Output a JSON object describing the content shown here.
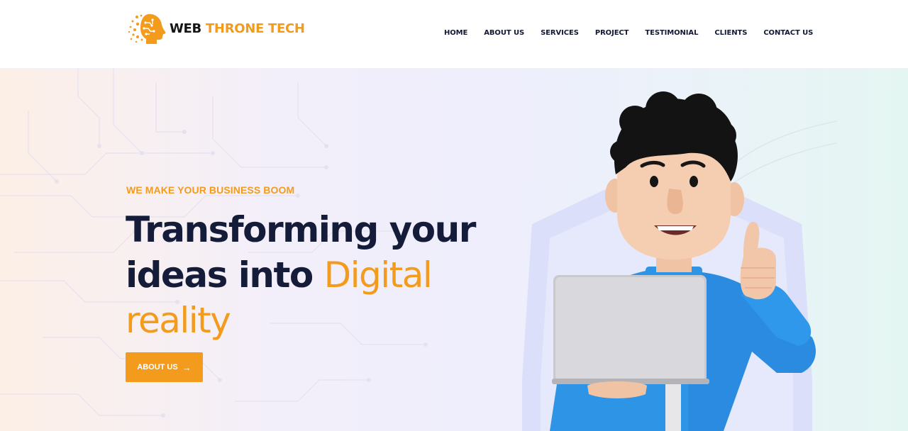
{
  "brand": {
    "name_part1": "WEB",
    "name_part2": "THRONE TECH",
    "accent_color": "#f29b1d",
    "dark_color": "#141c3a",
    "icon": "ai-head-logo-icon"
  },
  "nav": {
    "items": [
      {
        "label": "HOME"
      },
      {
        "label": "ABOUT US"
      },
      {
        "label": "SERVICES"
      },
      {
        "label": "PROJECT"
      },
      {
        "label": "TESTIMONIAL"
      },
      {
        "label": "CLIENTS"
      },
      {
        "label": "CONTACT US"
      }
    ]
  },
  "hero": {
    "eyebrow": "WE MAKE YOUR BUSINESS BOOM",
    "headline_line1": "Transforming your",
    "headline_line2_dark": "ideas into ",
    "headline_line2_accent": "Digital",
    "headline_line3_accent": "reality",
    "cta_label": "ABOUT US",
    "cta_icon": "arrow-right-icon",
    "illustration": "3d-character-with-laptop-thumbs-up"
  }
}
